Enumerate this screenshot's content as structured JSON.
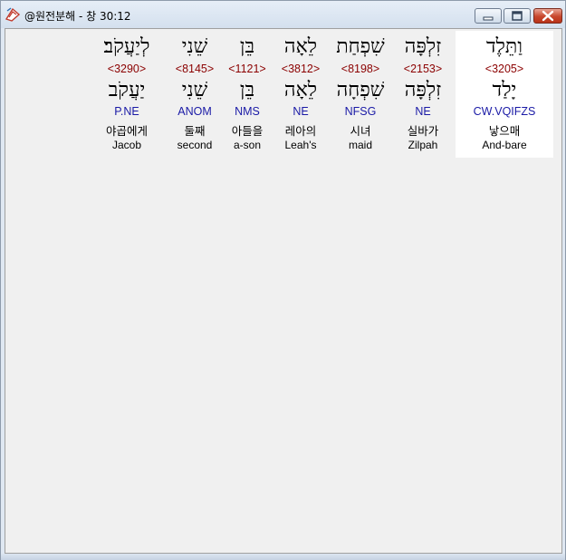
{
  "window": {
    "title": "@원전분해 - 창 30:12"
  },
  "words": [
    {
      "hebrew": "וַתֵּלֶד",
      "strong": "<3205>",
      "root": "יָלַד",
      "morph": "CW.VQIFZS",
      "korean": "낳으매",
      "english": "And-bare",
      "selected": true
    },
    {
      "hebrew": "זִלְפָּה",
      "strong": "<2153>",
      "root": "זִלְפָּה",
      "morph": "NE",
      "korean": "실바가",
      "english": "Zilpah",
      "selected": false
    },
    {
      "hebrew": "שִׁפְחַת",
      "strong": "<8198>",
      "root": "שִׁפְחָה",
      "morph": "NFSG",
      "korean": "시녀",
      "english": "maid",
      "selected": false
    },
    {
      "hebrew": "לֵאָה",
      "strong": "<3812>",
      "root": "לֵאָה",
      "morph": "NE",
      "korean": "레아의",
      "english": "Leah's",
      "selected": false
    },
    {
      "hebrew": "בֵּן",
      "strong": "<1121>",
      "root": "בֵּן",
      "morph": "NMS",
      "korean": "아들을",
      "english": "a-son",
      "selected": false
    },
    {
      "hebrew": "שֵׁנִי",
      "strong": "<8145>",
      "root": "שֵׁנִי",
      "morph": "ANOM",
      "korean": "둘째",
      "english": "second",
      "selected": false
    },
    {
      "hebrew": "לְיַעֲקֹב׃",
      "strong": "<3290>",
      "root": "יַעֲקֹב",
      "morph": "P.NE",
      "korean": "야곱에게",
      "english": "Jacob",
      "selected": false
    }
  ]
}
